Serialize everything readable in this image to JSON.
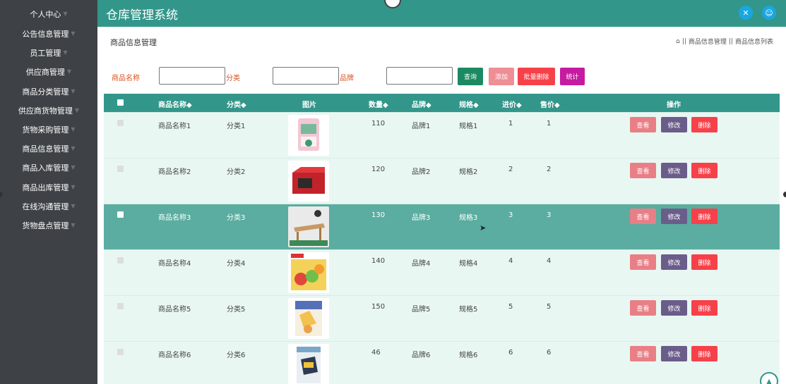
{
  "app": {
    "title": "仓库管理系统"
  },
  "sidebar": {
    "items": [
      {
        "label": "个人中心"
      },
      {
        "label": "公告信息管理"
      },
      {
        "label": "员工管理"
      },
      {
        "label": "供应商管理"
      },
      {
        "label": "商品分类管理"
      },
      {
        "label": "供应商货物管理"
      },
      {
        "label": "货物采购管理"
      },
      {
        "label": "商品信息管理"
      },
      {
        "label": "商品入库管理"
      },
      {
        "label": "商品出库管理"
      },
      {
        "label": "在线沟通管理"
      },
      {
        "label": "货物盘点管理"
      }
    ]
  },
  "page": {
    "title": "商品信息管理",
    "breadcrumb": [
      "商品信息管理",
      "商品信息列表"
    ],
    "breadcrumb_sep": "||"
  },
  "search": {
    "name_label": "商品名称",
    "category_label": "分类",
    "brand_label": "品牌",
    "name_value": "",
    "category_value": "",
    "brand_value": "",
    "query": "查询",
    "add": "添加",
    "batch_delete": "批量删除",
    "stats": "统计"
  },
  "table": {
    "headers": {
      "name": "商品名称",
      "category": "分类",
      "image": "图片",
      "quantity": "数量",
      "brand": "品牌",
      "spec": "规格",
      "purchase_price": "进价",
      "sale_price": "售价",
      "actions": "操作"
    },
    "sort_marker": "◆",
    "actions": {
      "view": "查看",
      "edit": "修改",
      "delete": "删除"
    },
    "rows": [
      {
        "name": "商品名称1",
        "category": "分类1",
        "quantity": "110",
        "brand": "品牌1",
        "spec": "规格1",
        "purchase_price": "1",
        "sale_price": "1"
      },
      {
        "name": "商品名称2",
        "category": "分类2",
        "quantity": "120",
        "brand": "品牌2",
        "spec": "规格2",
        "purchase_price": "2",
        "sale_price": "2"
      },
      {
        "name": "商品名称3",
        "category": "分类3",
        "quantity": "130",
        "brand": "品牌3",
        "spec": "规格3",
        "purchase_price": "3",
        "sale_price": "3"
      },
      {
        "name": "商品名称4",
        "category": "分类4",
        "quantity": "140",
        "brand": "品牌4",
        "spec": "规格4",
        "purchase_price": "4",
        "sale_price": "4"
      },
      {
        "name": "商品名称5",
        "category": "分类5",
        "quantity": "150",
        "brand": "品牌5",
        "spec": "规格5",
        "purchase_price": "5",
        "sale_price": "5"
      },
      {
        "name": "商品名称6",
        "category": "分类6",
        "quantity": "46",
        "brand": "品牌6",
        "spec": "规格6",
        "purchase_price": "6",
        "sale_price": "6"
      }
    ]
  },
  "colors": {
    "primary": "#33968a",
    "sidebar": "#3e4246",
    "row": "#e9f7f3",
    "row_highlight": "#5aada0",
    "view": "#e97f86",
    "edit": "#6a5d8a",
    "delete": "#f6414a"
  },
  "icons": {
    "header_left": "fullscreen-icon",
    "header_right": "user-icon",
    "breadcrumb": "home-icon",
    "scroll": "back-to-top-icon"
  }
}
